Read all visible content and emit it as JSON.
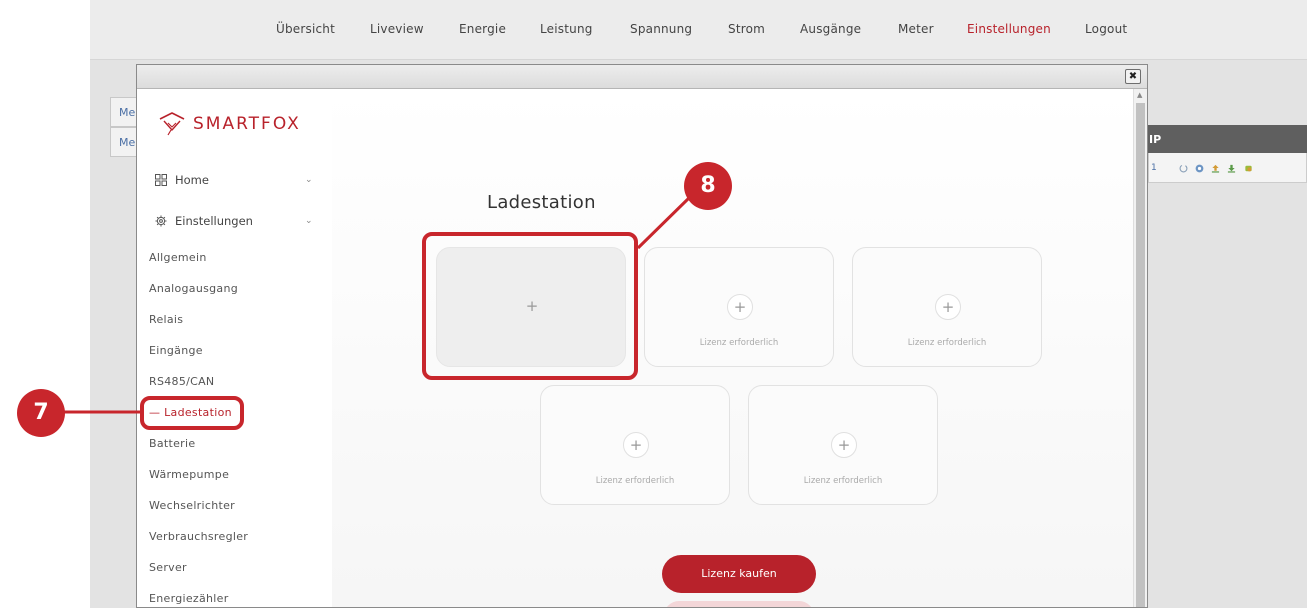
{
  "nav": {
    "items": [
      {
        "label": "Übersicht",
        "active": false
      },
      {
        "label": "Liveview",
        "active": false
      },
      {
        "label": "Energie",
        "active": false
      },
      {
        "label": "Leistung",
        "active": false
      },
      {
        "label": "Spannung",
        "active": false
      },
      {
        "label": "Strom",
        "active": false
      },
      {
        "label": "Ausgänge",
        "active": false
      },
      {
        "label": "Meter",
        "active": false
      },
      {
        "label": "Einstellungen",
        "active": true
      },
      {
        "label": "Logout",
        "active": false
      }
    ]
  },
  "background": {
    "tab1": "Me",
    "tab2": "Me",
    "panel_header": "IP",
    "panel_row_text": "1"
  },
  "dialog": {
    "close_glyph": "✖"
  },
  "sidebar": {
    "brand": "SMARTFOX",
    "sections": [
      {
        "label": "Home",
        "icon": "grid-icon"
      },
      {
        "label": "Einstellungen",
        "icon": "gear-icon"
      }
    ],
    "chevron": "⌄",
    "items": [
      {
        "label": "Allgemein",
        "active": false
      },
      {
        "label": "Analogausgang",
        "active": false
      },
      {
        "label": "Relais",
        "active": false
      },
      {
        "label": "Eingänge",
        "active": false
      },
      {
        "label": "RS485/CAN",
        "active": false
      },
      {
        "label": "— Ladestation",
        "active": true
      },
      {
        "label": "Batterie",
        "active": false
      },
      {
        "label": "Wärmepumpe",
        "active": false
      },
      {
        "label": "Wechselrichter",
        "active": false
      },
      {
        "label": "Verbrauchsregler",
        "active": false
      },
      {
        "label": "Server",
        "active": false
      },
      {
        "label": "Energiezähler",
        "active": false
      }
    ]
  },
  "main": {
    "title": "Ladestation",
    "plus_glyph": "+",
    "slots": [
      {
        "license_text": ""
      },
      {
        "license_text": "Lizenz erforderlich"
      },
      {
        "license_text": "Lizenz erforderlich"
      },
      {
        "license_text": "Lizenz erforderlich"
      },
      {
        "license_text": "Lizenz erforderlich"
      }
    ],
    "buy_button": "Lizenz kaufen"
  },
  "annotations": {
    "marker_7": "7",
    "marker_8": "8"
  },
  "colors": {
    "accent": "#b8222b",
    "annotation": "#c8262c"
  }
}
